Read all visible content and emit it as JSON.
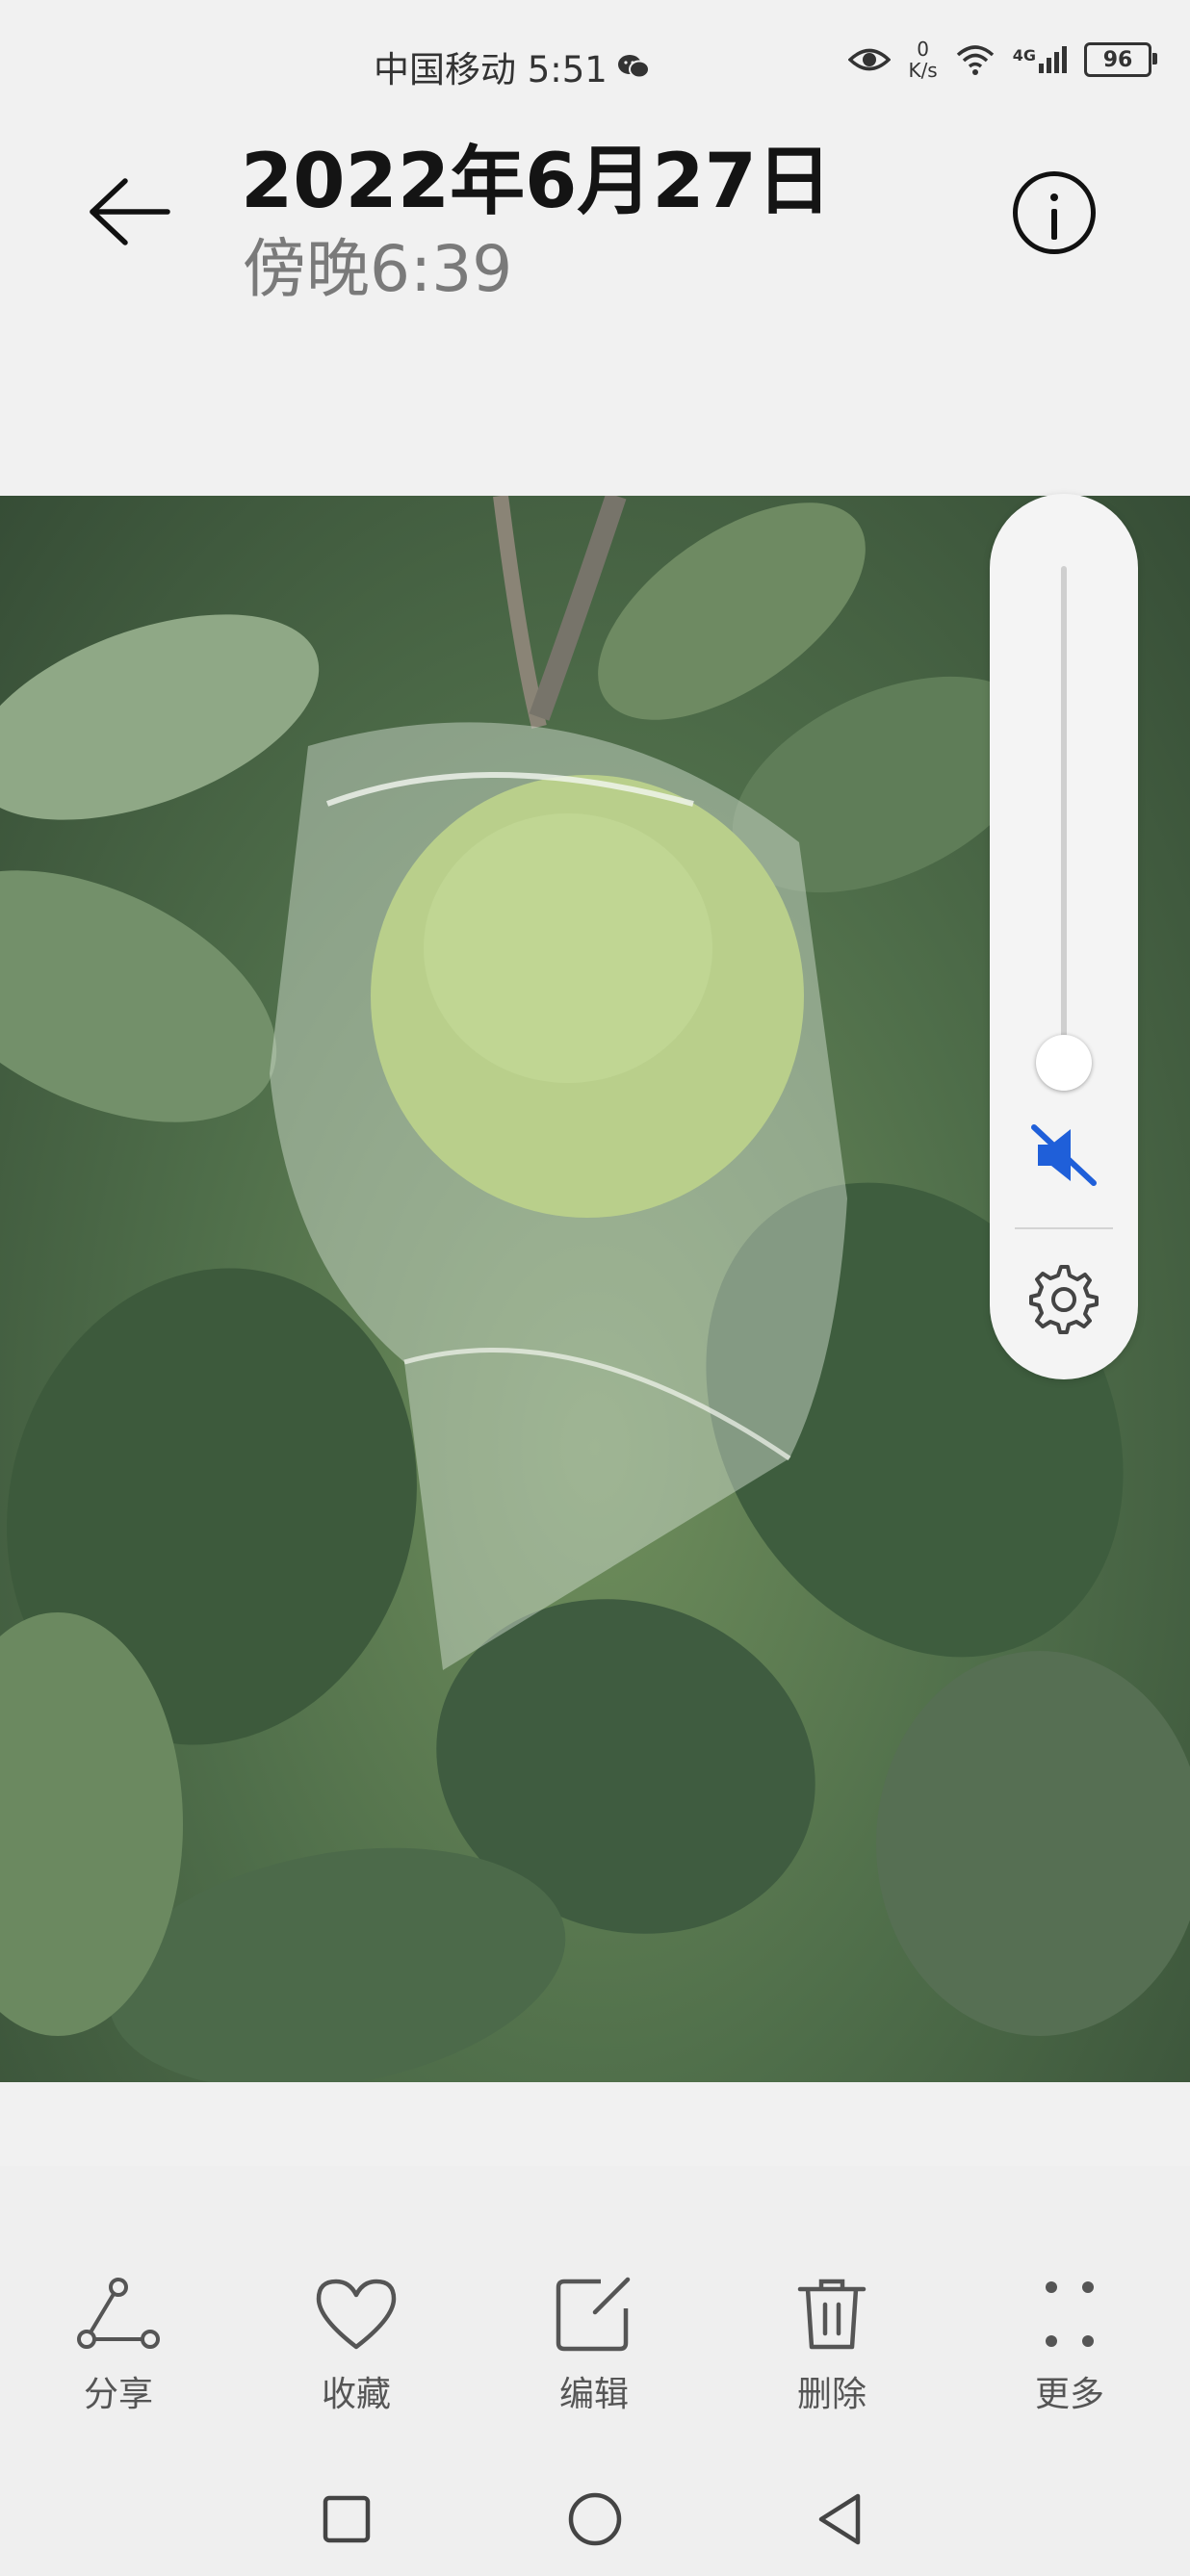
{
  "status_bar": {
    "carrier_time": "中国移动 5:51",
    "net_speed_value": "0",
    "net_speed_unit": "K/s",
    "network_label": "4G",
    "battery": "96",
    "icons": [
      "wechat-icon",
      "eye-icon",
      "wifi-icon",
      "signal-icon",
      "battery-icon"
    ]
  },
  "header": {
    "date": "2022年6月27日",
    "time": "傍晚6:39"
  },
  "volume_panel": {
    "level": 0,
    "muted": true,
    "accent_color": "#1f5fd9"
  },
  "toolbar": {
    "share": "分享",
    "favorite": "收藏",
    "edit": "编辑",
    "delete": "删除",
    "more": "更多"
  },
  "nav": {
    "buttons": [
      "recents-button",
      "home-button",
      "back-nav-button"
    ]
  }
}
